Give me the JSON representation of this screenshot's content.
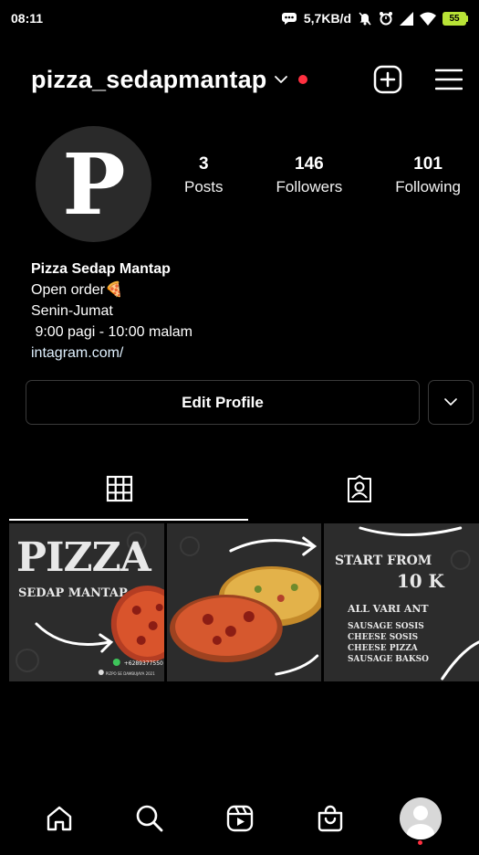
{
  "status_bar": {
    "time": "08:11",
    "network_speed": "5,7KB/d",
    "battery_level": "55"
  },
  "header": {
    "username": "pizza_sedapmantap",
    "icons": [
      "chevron-down-icon",
      "new-post-icon",
      "menu-icon"
    ]
  },
  "profile": {
    "avatar_letter": "P",
    "stats": [
      {
        "count": "3",
        "label": "Posts"
      },
      {
        "count": "146",
        "label": "Followers"
      },
      {
        "count": "101",
        "label": "Following"
      }
    ]
  },
  "bio": {
    "name": "Pizza Sedap Mantap",
    "line1": "Open order🍕",
    "line2": "Senin-Jumat",
    "line3": " 9:00 pagi - 10:00 malam",
    "link": "intagram.com/"
  },
  "actions": {
    "edit_profile": "Edit Profile"
  },
  "tabs": [
    "grid-icon",
    "tagged-icon"
  ],
  "posts": [
    {
      "title": "PIZZA",
      "subtitle": "SEDAP MANTAP",
      "phone": "+6289377550",
      "footer": "PIZPO SE DAMBUJAYA 2021"
    },
    {},
    {
      "heading1": "START FROM",
      "heading2": "10 K",
      "list_title": "ALL VARI ANT",
      "items": [
        "SAUSAGE SOSIS",
        "CHEESE SOSIS",
        "CHEESE PIZZA",
        "SAUSAGE BAKSO"
      ]
    }
  ],
  "bottom_nav": [
    "home-icon",
    "search-icon",
    "reels-icon",
    "shop-icon",
    "profile-avatar"
  ],
  "colors": {
    "background": "#000000",
    "notification_red": "#ff3040",
    "battery": "#b8e336",
    "border": "#3a3a3a"
  }
}
